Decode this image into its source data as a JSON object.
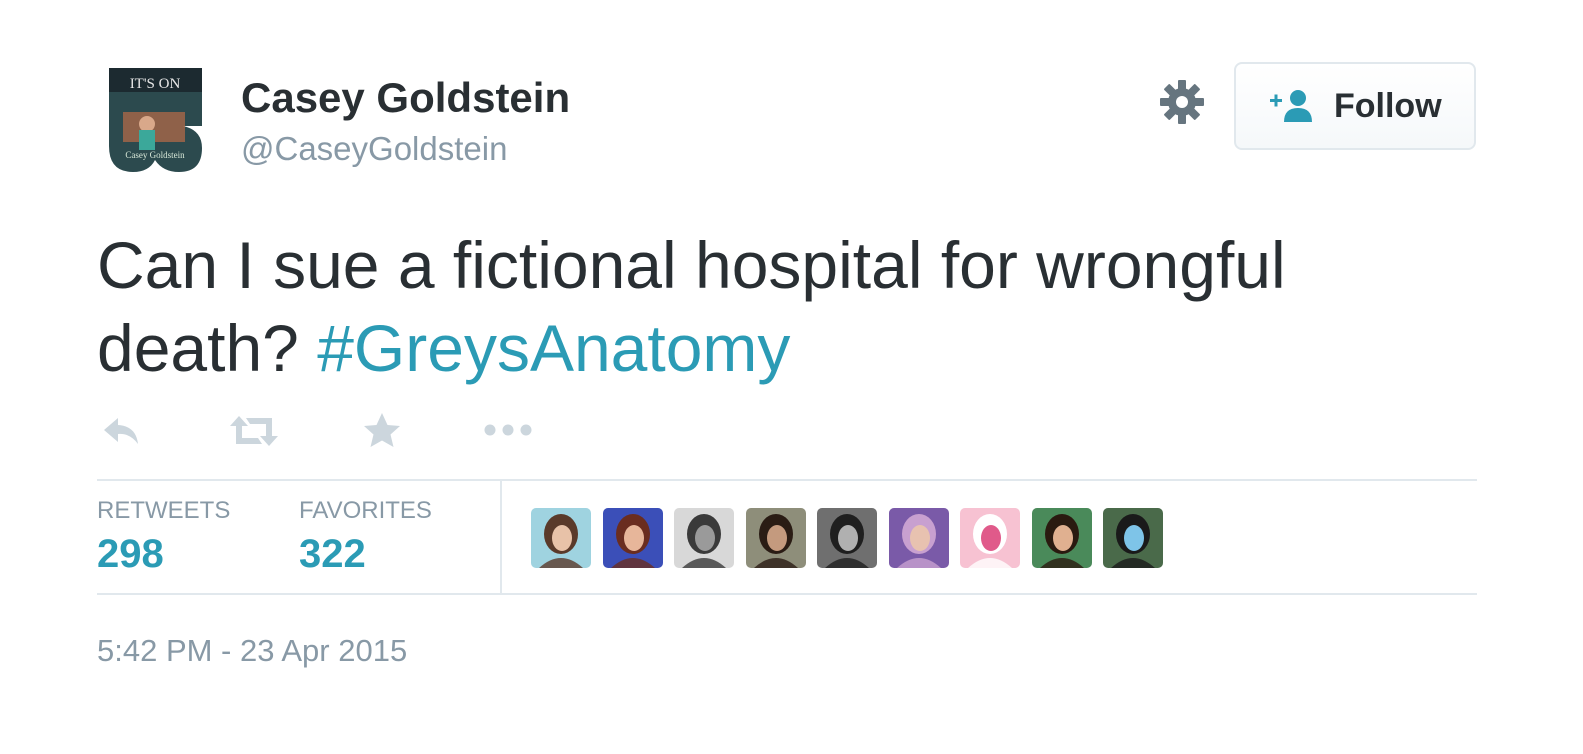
{
  "user": {
    "display_name": "Casey Goldstein",
    "handle": "@CaseyGoldstein",
    "avatar_text_top": "IT'S ON",
    "avatar_text_bottom": "Casey Goldstein"
  },
  "follow_button": {
    "label": "Follow",
    "icon": "add-user-icon"
  },
  "settings": {
    "icon": "gear-icon"
  },
  "tweet": {
    "text": "Can I sue a fictional hospital for wrongful death?",
    "hashtag": "#GreysAnatomy"
  },
  "actions": [
    "reply-icon",
    "retweet-icon",
    "favorite-icon",
    "more-icon"
  ],
  "stats": {
    "retweets_label": "RETWEETS",
    "retweets_value": "298",
    "favorites_label": "FAVORITES",
    "favorites_value": "322"
  },
  "favoriters": [
    {
      "name": "favoriter-avatar-1",
      "colors": [
        "#9fd3e0",
        "#5a3a2a",
        "#e8c2a8"
      ]
    },
    {
      "name": "favoriter-avatar-2",
      "colors": [
        "#3b4fb8",
        "#6a2d20",
        "#e7b69a"
      ]
    },
    {
      "name": "favoriter-avatar-3",
      "colors": [
        "#d8d8d8",
        "#3a3a3a",
        "#9a9a9a"
      ]
    },
    {
      "name": "favoriter-avatar-4",
      "colors": [
        "#8e8e7a",
        "#2a1c14",
        "#c49a7e"
      ]
    },
    {
      "name": "favoriter-avatar-5",
      "colors": [
        "#6f6f6f",
        "#1f1f1f",
        "#b0b0b0"
      ]
    },
    {
      "name": "favoriter-avatar-6",
      "colors": [
        "#7a5aa8",
        "#c8a0d0",
        "#e8c2b0"
      ]
    },
    {
      "name": "favoriter-avatar-7",
      "colors": [
        "#f7c2d2",
        "#ffffff",
        "#e05a8a"
      ]
    },
    {
      "name": "favoriter-avatar-8",
      "colors": [
        "#4a8a5a",
        "#2a1a10",
        "#e0b090"
      ]
    },
    {
      "name": "favoriter-avatar-9",
      "colors": [
        "#4a6a4a",
        "#1a1a1a",
        "#7ec4e8"
      ]
    }
  ],
  "timestamp": "5:42 PM - 23 Apr 2015",
  "colors": {
    "link": "#2b9bb5",
    "muted": "#8899a6",
    "text": "#292f33",
    "divider": "#e1e8ed",
    "icon": "#ccd6dd"
  }
}
